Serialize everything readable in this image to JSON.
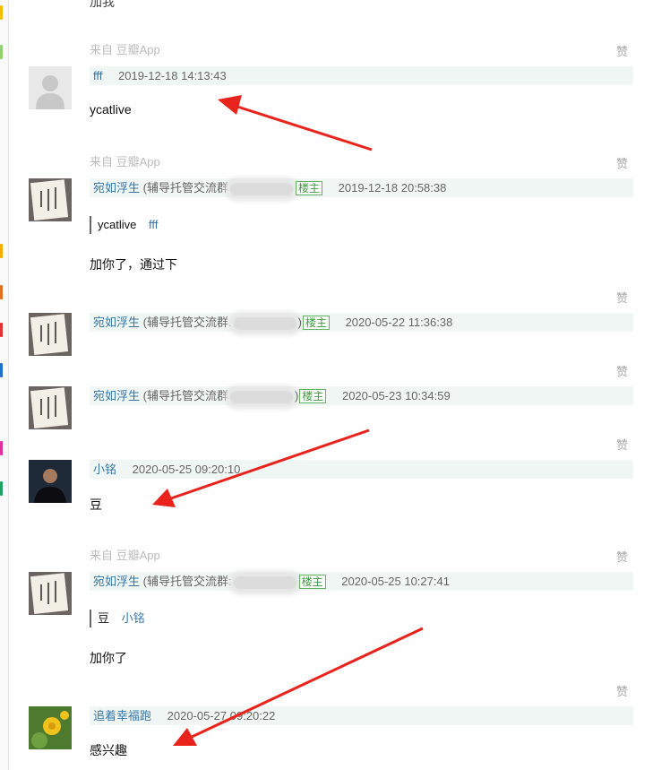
{
  "top_partial_text": "加我",
  "comments": [
    {
      "source": "来自 豆瓣App",
      "like": "赞",
      "author": "fff",
      "time": "2019-12-18 14:13:43",
      "content": "ycatlive"
    },
    {
      "source": "来自 豆瓣App",
      "like": "赞",
      "author": "宛如浮生",
      "group": "(辅导托管交流群",
      "badge": "楼主",
      "time": "2019-12-18 20:58:38",
      "quote_text": "ycatlive",
      "quote_author": "fff",
      "content": "加你了，通过下"
    },
    {
      "like": "赞",
      "author": "宛如浮生",
      "group": "(辅导托管交流群.",
      "group_end": ")",
      "badge": "楼主",
      "time": "2020-05-22 11:36:38"
    },
    {
      "like": "赞",
      "author": "宛如浮生",
      "group": "(辅导托管交流群",
      "group_end": ")",
      "badge": "楼主",
      "time": "2020-05-23 10:34:59"
    },
    {
      "like": "赞",
      "author": "小铭",
      "time": "2020-05-25 09:20:10",
      "content": "豆"
    },
    {
      "source": "来自 豆瓣App",
      "like": "赞",
      "author": "宛如浮生",
      "group": "(辅导托管交流群:",
      "badge": "楼主",
      "time": "2020-05-25 10:27:41",
      "quote_text": "豆",
      "quote_author": "小铭",
      "content": "加你了"
    },
    {
      "like": "赞",
      "author": "追着幸福跑",
      "time": "2020-05-27 09:20:22",
      "content": "感兴趣"
    }
  ],
  "colors": {
    "link": "#3377aa",
    "meta_bg": "#f0f6f3",
    "badge": "#62b262",
    "arrow": "#e8231c"
  },
  "icons": [
    "default-avatar-icon",
    "calligraphy-avatar-icon",
    "person-photo-avatar-icon",
    "flower-avatar-icon"
  ]
}
